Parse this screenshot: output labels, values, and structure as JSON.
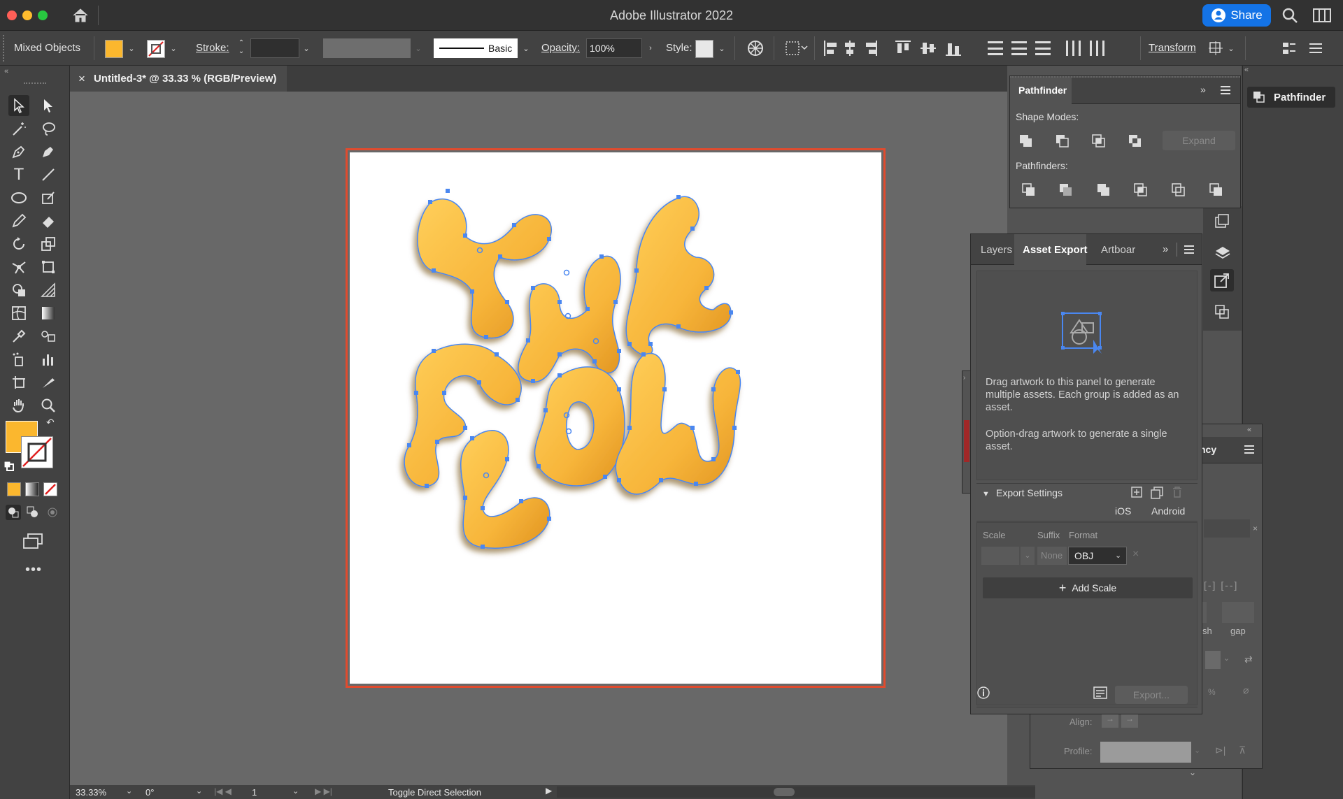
{
  "window": {
    "title": "Adobe Illustrator 2022",
    "share_label": "Share"
  },
  "controlbar": {
    "selection_label": "Mixed Objects",
    "fill_color": "#fbb72e",
    "stroke_label": "Stroke:",
    "brush_label": "Basic",
    "opacity_label": "Opacity:",
    "opacity_value": "100%",
    "style_label": "Style:",
    "transform_label": "Transform"
  },
  "document": {
    "tab_title": "Untitled-3* @ 33.33 % (RGB/Preview)",
    "close_glyph": "×"
  },
  "artwork": {
    "text_line1": "THE",
    "text_line2": "FLOW",
    "fill_color": "#f6b93a",
    "anchor_color": "#4a87f0"
  },
  "pathfinder": {
    "title": "Pathfinder",
    "shape_modes_label": "Shape Modes:",
    "expand_label": "Expand",
    "pathfinders_label": "Pathfinders:",
    "collapsed_title": "Pathfinder"
  },
  "asset_export": {
    "tabs": [
      "Layers",
      "Asset Export",
      "Artboar"
    ],
    "active_tab": "Asset Export",
    "drop_text": "Drag artwork to this panel to generate multiple assets. Each group is added as an asset.",
    "option_text": "Option-drag artwork to generate a single asset.",
    "export_settings_label": "Export Settings",
    "ios_label": "iOS",
    "android_label": "Android",
    "col_scale": "Scale",
    "col_suffix": "Suffix",
    "col_format": "Format",
    "suffix_placeholder": "None",
    "format_value": "OBJ",
    "add_scale_label": "Add Scale",
    "export_button": "Export..."
  },
  "transparency_panel": {
    "title_fragment": "ncy",
    "dash_label": "sh",
    "gap_label": "gap",
    "align_label": "Align:",
    "profile_label": "Profile:"
  },
  "statusbar": {
    "zoom": "33.33%",
    "rotation": "0°",
    "artboard_num": "1",
    "message": "Toggle Direct Selection"
  }
}
